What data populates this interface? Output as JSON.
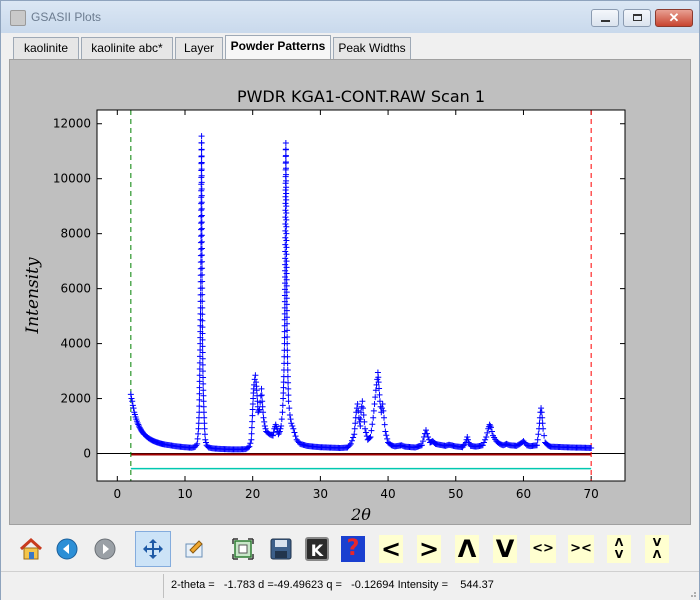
{
  "window": {
    "title": "GSASII Plots"
  },
  "tabs": [
    {
      "label": "kaolinite",
      "active": false
    },
    {
      "label": "kaolinite abc*",
      "active": false
    },
    {
      "label": "Layer",
      "active": false
    },
    {
      "label": "Powder Patterns",
      "active": true
    },
    {
      "label": "Peak Widths",
      "active": false
    }
  ],
  "chart_data": {
    "type": "scatter",
    "title": "PWDR KGA1-CONT.RAW Scan 1",
    "xlabel": "2θ",
    "ylabel": "Intensity",
    "xlim": [
      -3,
      75
    ],
    "ylim": [
      -1000,
      12500
    ],
    "x_ticks": [
      0,
      10,
      20,
      30,
      40,
      50,
      60,
      70
    ],
    "y_ticks": [
      0,
      2000,
      4000,
      6000,
      8000,
      10000,
      12000
    ],
    "grid": false,
    "limit_lines": [
      {
        "x": 2.0,
        "color": "#008000"
      },
      {
        "x": 70.0,
        "color": "#ff0000"
      }
    ],
    "zero_line": 0,
    "background_level": 0,
    "reflection_tick_level": -550,
    "series": [
      {
        "marker": "+",
        "color": "#0000ff",
        "points": [
          [
            2.0,
            2150
          ],
          [
            2.1,
            2000
          ],
          [
            2.2,
            1900
          ],
          [
            2.3,
            1750
          ],
          [
            2.4,
            1650
          ],
          [
            2.5,
            1500
          ],
          [
            2.6,
            1420
          ],
          [
            2.7,
            1330
          ],
          [
            2.8,
            1250
          ],
          [
            2.9,
            1180
          ],
          [
            3.0,
            1110
          ],
          [
            3.2,
            1000
          ],
          [
            3.4,
            900
          ],
          [
            3.6,
            820
          ],
          [
            3.8,
            750
          ],
          [
            4.0,
            690
          ],
          [
            4.3,
            620
          ],
          [
            4.6,
            560
          ],
          [
            5.0,
            500
          ],
          [
            5.4,
            450
          ],
          [
            5.8,
            410
          ],
          [
            6.2,
            380
          ],
          [
            6.6,
            350
          ],
          [
            7.0,
            330
          ],
          [
            7.5,
            310
          ],
          [
            8.0,
            290
          ],
          [
            8.5,
            270
          ],
          [
            9.0,
            255
          ],
          [
            9.5,
            240
          ],
          [
            10.0,
            230
          ],
          [
            10.5,
            220
          ],
          [
            11.0,
            210
          ],
          [
            11.5,
            240
          ],
          [
            11.8,
            350
          ],
          [
            12.0,
            900
          ],
          [
            12.1,
            1500
          ],
          [
            12.15,
            2400
          ],
          [
            12.2,
            3300
          ],
          [
            12.25,
            4000
          ],
          [
            12.3,
            5300
          ],
          [
            12.35,
            7200
          ],
          [
            12.4,
            9800
          ],
          [
            12.45,
            11550
          ],
          [
            12.5,
            7700
          ],
          [
            12.55,
            5300
          ],
          [
            12.6,
            3900
          ],
          [
            12.65,
            3000
          ],
          [
            12.7,
            2300
          ],
          [
            12.8,
            1500
          ],
          [
            12.9,
            900
          ],
          [
            13.0,
            500
          ],
          [
            13.2,
            300
          ],
          [
            13.5,
            220
          ],
          [
            14.0,
            190
          ],
          [
            15.0,
            170
          ],
          [
            16.0,
            160
          ],
          [
            17.0,
            150
          ],
          [
            18.0,
            150
          ],
          [
            19.0,
            160
          ],
          [
            19.5,
            250
          ],
          [
            19.8,
            500
          ],
          [
            20.0,
            1600
          ],
          [
            20.1,
            2200
          ],
          [
            20.2,
            2500
          ],
          [
            20.3,
            2700
          ],
          [
            20.4,
            2850
          ],
          [
            20.5,
            2600
          ],
          [
            20.6,
            2300
          ],
          [
            20.7,
            1900
          ],
          [
            20.8,
            1500
          ],
          [
            21.0,
            1600
          ],
          [
            21.2,
            2100
          ],
          [
            21.3,
            2350
          ],
          [
            21.4,
            1900
          ],
          [
            21.6,
            1300
          ],
          [
            21.8,
            1000
          ],
          [
            22.0,
            800
          ],
          [
            22.5,
            700
          ],
          [
            23.0,
            650
          ],
          [
            23.2,
            900
          ],
          [
            23.4,
            1050
          ],
          [
            23.6,
            900
          ],
          [
            23.8,
            700
          ],
          [
            24.0,
            800
          ],
          [
            24.2,
            1000
          ],
          [
            24.4,
            1500
          ],
          [
            24.5,
            2000
          ],
          [
            24.6,
            2800
          ],
          [
            24.7,
            4000
          ],
          [
            24.75,
            5300
          ],
          [
            24.8,
            7100
          ],
          [
            24.85,
            9100
          ],
          [
            24.9,
            11300
          ],
          [
            24.95,
            9000
          ],
          [
            25.0,
            7000
          ],
          [
            25.05,
            5200
          ],
          [
            25.1,
            4000
          ],
          [
            25.2,
            2800
          ],
          [
            25.3,
            1900
          ],
          [
            25.5,
            1400
          ],
          [
            25.7,
            1100
          ],
          [
            26.0,
            900
          ],
          [
            26.5,
            500
          ],
          [
            27.0,
            350
          ],
          [
            28.0,
            280
          ],
          [
            29.0,
            250
          ],
          [
            30.0,
            230
          ],
          [
            31.0,
            220
          ],
          [
            32.0,
            210
          ],
          [
            33.0,
            200
          ],
          [
            34.0,
            220
          ],
          [
            34.5,
            350
          ],
          [
            35.0,
            700
          ],
          [
            35.3,
            1500
          ],
          [
            35.5,
            1800
          ],
          [
            35.7,
            1300
          ],
          [
            35.9,
            1000
          ],
          [
            36.0,
            1500
          ],
          [
            36.2,
            1900
          ],
          [
            36.4,
            1400
          ],
          [
            36.6,
            900
          ],
          [
            37.0,
            500
          ],
          [
            37.4,
            600
          ],
          [
            37.8,
            1300
          ],
          [
            38.0,
            1800
          ],
          [
            38.2,
            2300
          ],
          [
            38.4,
            2700
          ],
          [
            38.5,
            2950
          ],
          [
            38.6,
            2600
          ],
          [
            38.8,
            1900
          ],
          [
            39.0,
            1500
          ],
          [
            39.2,
            1800
          ],
          [
            39.4,
            1300
          ],
          [
            39.6,
            800
          ],
          [
            40.0,
            400
          ],
          [
            40.5,
            300
          ],
          [
            41.0,
            260
          ],
          [
            42.0,
            300
          ],
          [
            42.5,
            250
          ],
          [
            43.0,
            240
          ],
          [
            44.0,
            220
          ],
          [
            45.0,
            300
          ],
          [
            45.3,
            600
          ],
          [
            45.6,
            850
          ],
          [
            45.9,
            600
          ],
          [
            46.2,
            400
          ],
          [
            46.6,
            450
          ],
          [
            47.0,
            350
          ],
          [
            48.0,
            300
          ],
          [
            48.5,
            280
          ],
          [
            49.0,
            320
          ],
          [
            50.0,
            260
          ],
          [
            51.0,
            230
          ],
          [
            51.5,
            400
          ],
          [
            51.7,
            600
          ],
          [
            51.9,
            400
          ],
          [
            52.2,
            280
          ],
          [
            53.0,
            250
          ],
          [
            54.0,
            300
          ],
          [
            54.5,
            600
          ],
          [
            54.8,
            900
          ],
          [
            55.0,
            1050
          ],
          [
            55.2,
            950
          ],
          [
            55.5,
            650
          ],
          [
            56.0,
            450
          ],
          [
            56.5,
            350
          ],
          [
            57.0,
            300
          ],
          [
            57.5,
            350
          ],
          [
            58.0,
            300
          ],
          [
            59.0,
            280
          ],
          [
            59.5,
            350
          ],
          [
            60.0,
            450
          ],
          [
            60.5,
            300
          ],
          [
            61.0,
            270
          ],
          [
            62.0,
            300
          ],
          [
            62.3,
            900
          ],
          [
            62.5,
            1500
          ],
          [
            62.6,
            1650
          ],
          [
            62.7,
            1500
          ],
          [
            62.9,
            900
          ],
          [
            63.2,
            400
          ],
          [
            63.6,
            300
          ],
          [
            64.0,
            250
          ],
          [
            65.0,
            240
          ],
          [
            66.0,
            230
          ],
          [
            67.0,
            220
          ],
          [
            68.0,
            215
          ],
          [
            69.0,
            210
          ],
          [
            70.0,
            200
          ]
        ]
      }
    ]
  },
  "toolbar": {
    "items": [
      {
        "name": "home-icon"
      },
      {
        "name": "back-icon"
      },
      {
        "name": "forward-icon"
      },
      {
        "name": "pan-icon",
        "pressed": true
      },
      {
        "name": "configure-subplots-icon"
      },
      {
        "name": "zoom-icon"
      },
      {
        "name": "save-icon"
      },
      {
        "name": "k-icon",
        "label": "K"
      },
      {
        "name": "help-icon",
        "label": "?"
      },
      {
        "name": "shift-left-icon",
        "label": "<"
      },
      {
        "name": "shift-right-icon",
        "label": ">"
      },
      {
        "name": "shift-up-icon",
        "label": "Λ"
      },
      {
        "name": "shift-down-icon",
        "label": "V"
      },
      {
        "name": "expand-x-icon",
        "label": "<>"
      },
      {
        "name": "contract-x-icon",
        "label": "><"
      },
      {
        "name": "expand-y-icon",
        "label": "Λ\nV"
      },
      {
        "name": "contract-y-icon",
        "label": "V\nΛ"
      }
    ]
  },
  "status": {
    "text": "2-theta =   -1.783 d =-49.49623 q =   -0.12694 Intensity =    544.37"
  }
}
